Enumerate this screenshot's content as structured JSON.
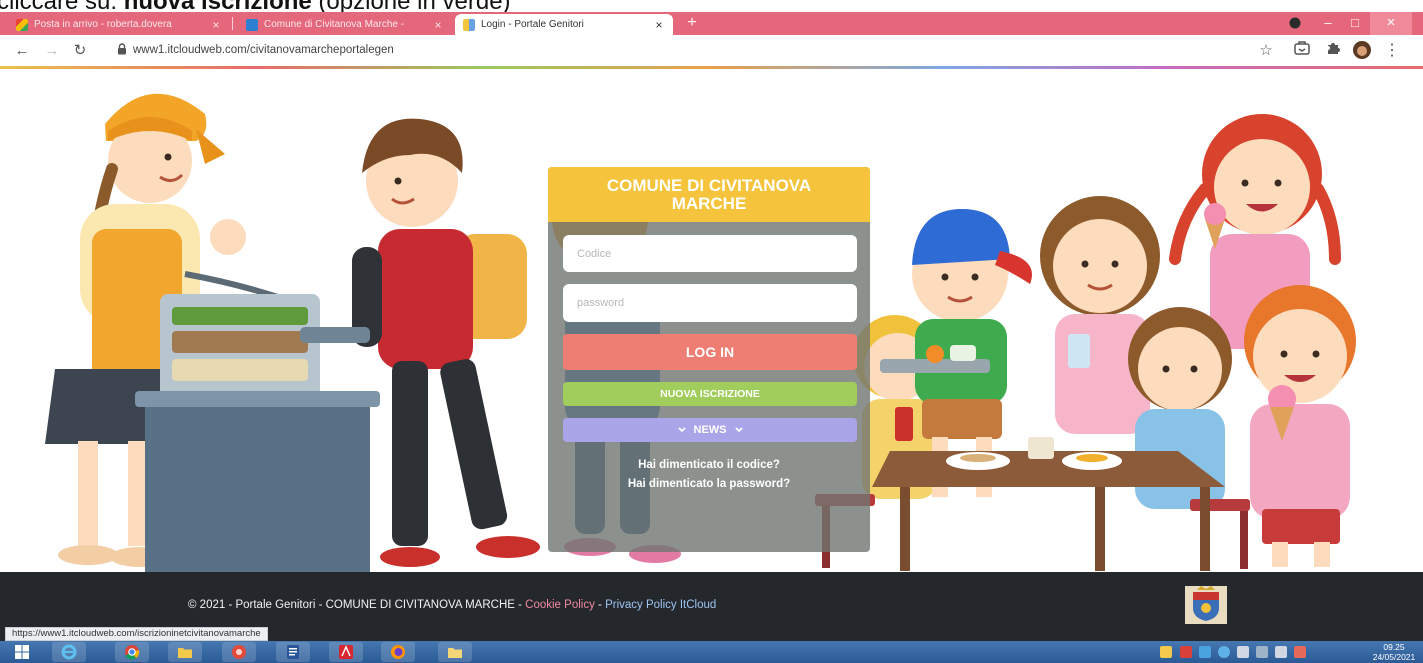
{
  "instruction": {
    "prefix": "cliccare su: ",
    "emphasis": "nuova iscrizione",
    "suffix": " (opzione in verde)"
  },
  "browser": {
    "frame_color": "#e5677b",
    "tabs": [
      {
        "title": "Posta in arrivo - roberta.dovera",
        "icon": "gmail-icon",
        "active": false
      },
      {
        "title": "Comune di Civitanova Marche -",
        "icon": "site-favicon-icon",
        "active": false
      },
      {
        "title": "Login - Portale Genitori",
        "icon": "portal-favicon-icon",
        "active": true
      }
    ],
    "close_glyph": "×",
    "new_tab": "+",
    "window_controls": {
      "minimize": "–",
      "maximize": "□",
      "close": "×"
    },
    "nav": {
      "back": "←",
      "forward": "→",
      "reload": "↻",
      "star": "☆",
      "menu": "⋮"
    },
    "url": "www1.itcloudweb.com/civitanovamarcheportalegen",
    "status_url": "https://www1.itcloudweb.com/iscrizioninetcivitanovamarche"
  },
  "login": {
    "title": "COMUNE DI CIVITANOVA MARCHE",
    "code_placeholder": "Codice",
    "password_placeholder": "password",
    "login_button": "LOG IN",
    "register_button": "NUOVA ISCRIZIONE",
    "news_button": "NEWS",
    "forgot_code": "Hai dimenticato il codice?",
    "forgot_password": "Hai dimenticato la password?",
    "colors": {
      "header": "#f5c43c",
      "login": "#ee7d73",
      "register": "#a0cd5c",
      "news": "#aaa4e8"
    }
  },
  "footer": {
    "copyright": "© 2021 - Portale Genitori - COMUNE DI CIVITANOVA MARCHE - ",
    "cookie_policy": "Cookie Policy",
    "separator": " - ",
    "privacy_policy": "Privacy Policy ItCloud",
    "logo": "civitanova-crest-icon"
  },
  "taskbar": {
    "apps": [
      "windows-start-icon",
      "internet-explorer-icon",
      "chrome-icon",
      "file-explorer-icon",
      "red-app-icon",
      "word-icon",
      "acrobat-icon",
      "firefox-icon",
      "folder-icon"
    ],
    "time": "09.25",
    "date": "24/05/2021"
  }
}
